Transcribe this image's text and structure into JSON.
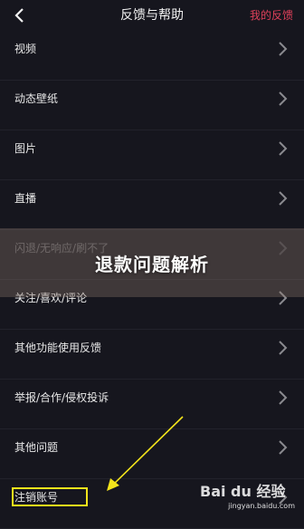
{
  "header": {
    "title": "反馈与帮助",
    "my_feedback": "我的反馈"
  },
  "items": [
    {
      "label": "视频"
    },
    {
      "label": "动态壁纸"
    },
    {
      "label": "图片"
    },
    {
      "label": "直播"
    },
    {
      "label": "闪退/无响应/刷不了"
    },
    {
      "label": "关注/喜欢/评论"
    },
    {
      "label": "其他功能使用反馈"
    },
    {
      "label": "举报/合作/侵权投诉"
    },
    {
      "label": "其他问题"
    },
    {
      "label": "注销账号"
    }
  ],
  "overlay": {
    "text": "退款问题解析"
  },
  "watermark": {
    "logo": "Bai du 经验",
    "url": "jingyan.baidu.com"
  },
  "colors": {
    "background": "#16161e",
    "accent_red": "#e0405a",
    "highlight_yellow": "#f4e41b"
  }
}
